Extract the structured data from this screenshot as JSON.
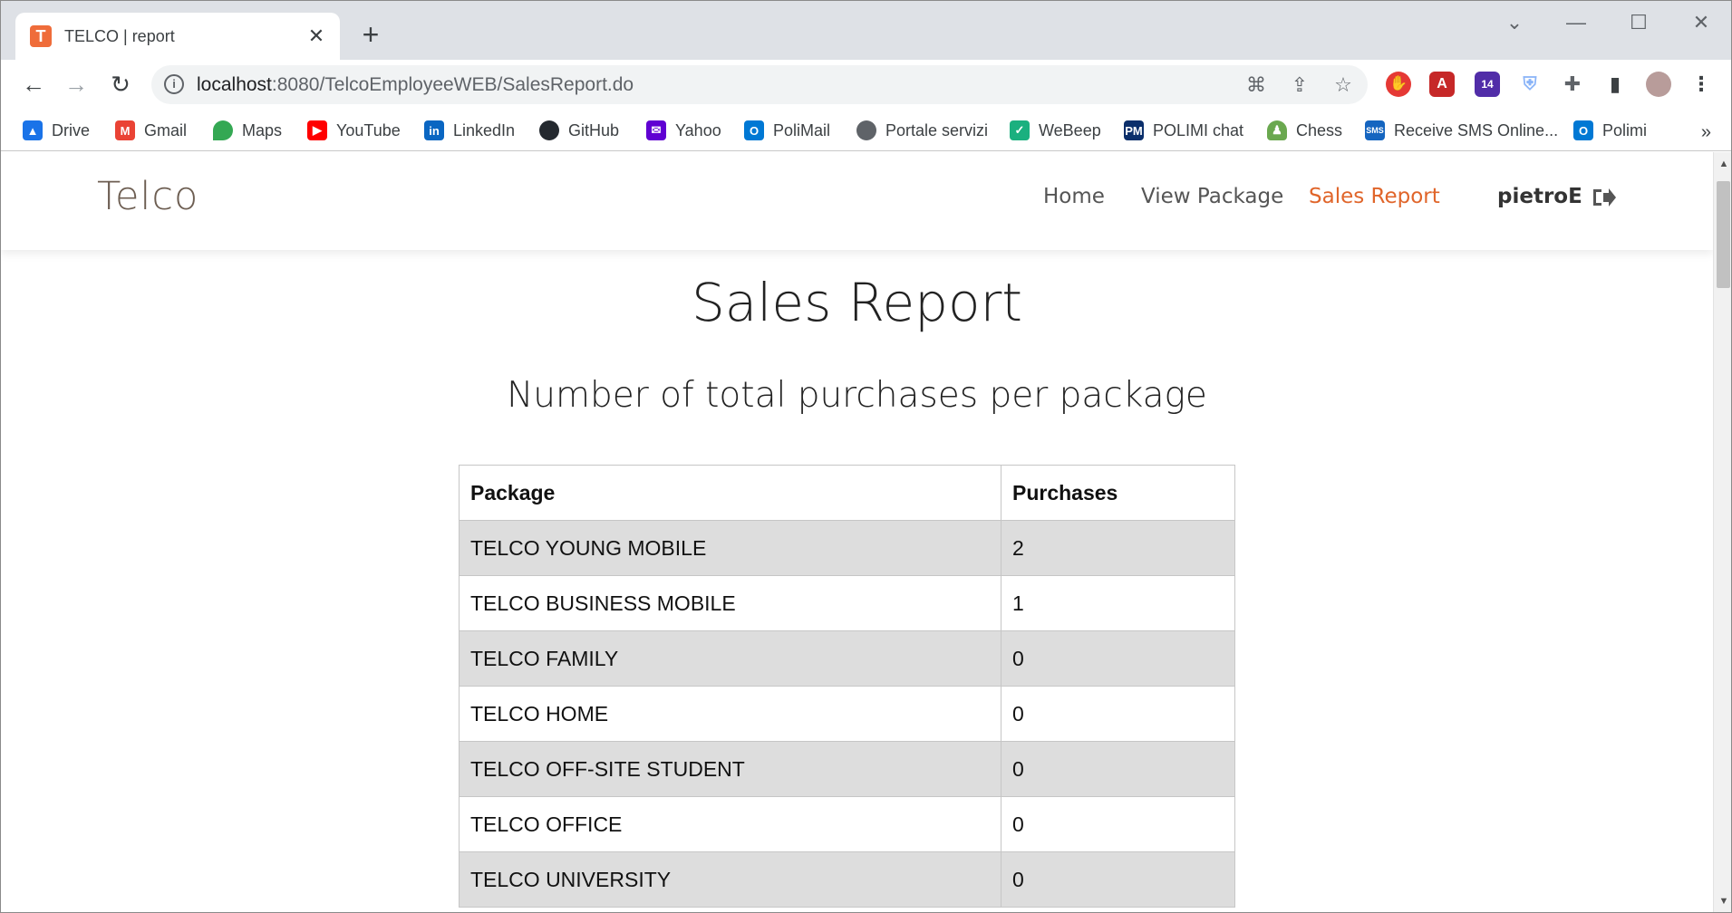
{
  "browser": {
    "tab_title": "TELCO | report",
    "tab_favicon_letter": "T",
    "url_host": "localhost",
    "url_rest": ":8080/TelcoEmployeeWEB/SalesReport.do",
    "extension_badge": "14",
    "bookmarks": [
      {
        "label": "Drive",
        "icon": "drive-icon",
        "color": "#1a73e8"
      },
      {
        "label": "Gmail",
        "icon": "gmail-icon",
        "color": "#ea4335"
      },
      {
        "label": "Maps",
        "icon": "maps-icon",
        "color": "#34a853"
      },
      {
        "label": "YouTube",
        "icon": "youtube-icon",
        "color": "#ff0000"
      },
      {
        "label": "LinkedIn",
        "icon": "linkedin-icon",
        "color": "#0a66c2"
      },
      {
        "label": "GitHub",
        "icon": "github-icon",
        "color": "#24292f"
      },
      {
        "label": "Yahoo",
        "icon": "yahoo-icon",
        "color": "#6001d2"
      },
      {
        "label": "PoliMail",
        "icon": "outlook-icon",
        "color": "#0078d4"
      },
      {
        "label": "Portale servizi",
        "icon": "globe-icon",
        "color": "#5f6368"
      },
      {
        "label": "WeBeep",
        "icon": "check-icon",
        "color": "#1bb07f"
      },
      {
        "label": "POLIMI chat",
        "icon": "pm-icon",
        "color": "#0b2f6b"
      },
      {
        "label": "Chess",
        "icon": "pawn-icon",
        "color": "#6aa84f"
      },
      {
        "label": "Receive SMS Online...",
        "icon": "sms-icon",
        "color": "#1565c0"
      },
      {
        "label": "Polimi",
        "icon": "outlook-icon",
        "color": "#0078d4"
      }
    ],
    "bookmarks_more": "»"
  },
  "nav": {
    "brand": "Telco",
    "links": [
      "Home",
      "View Package",
      "Sales Report"
    ],
    "active": "Sales Report",
    "user": "pietroE"
  },
  "main": {
    "title": "Sales Report",
    "subtitle": "Number of total purchases per package",
    "table": {
      "headers": [
        "Package",
        "Purchases"
      ],
      "rows": [
        [
          "TELCO YOUNG MOBILE",
          "2"
        ],
        [
          "TELCO BUSINESS MOBILE",
          "1"
        ],
        [
          "TELCO FAMILY",
          "0"
        ],
        [
          "TELCO HOME",
          "0"
        ],
        [
          "TELCO OFF-SITE STUDENT",
          "0"
        ],
        [
          "TELCO OFFICE",
          "0"
        ],
        [
          "TELCO UNIVERSITY",
          "0"
        ]
      ]
    }
  },
  "colors": {
    "accent": "#e0652a",
    "brand": "#6d5e52",
    "row_stripe": "#dddddd"
  }
}
